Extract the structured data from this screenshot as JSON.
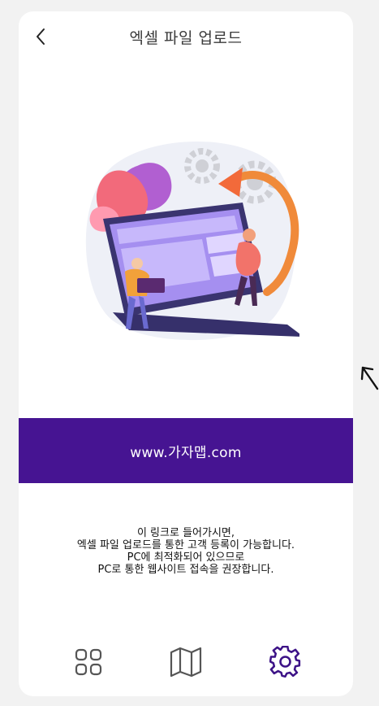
{
  "header": {
    "title": "엑셀 파일 업로드",
    "back_icon": "chevron-left-icon"
  },
  "banner": {
    "link_text": "www.가자맵.com",
    "background_color": "#461492",
    "text_color": "#ffffff"
  },
  "info": {
    "lines": [
      "이 링크로 들어가시면,",
      "엑셀 파일 업로드를 통한 고객 등록이 가능합니다.",
      "PC에 최적화되어 있으므로",
      "PC로 통한 웹사이트 접속을 권장합니다."
    ]
  },
  "bottom_nav": {
    "items": [
      {
        "icon": "grid-icon",
        "active": false,
        "color": "#555555"
      },
      {
        "icon": "map-icon",
        "active": false,
        "color": "#555555"
      },
      {
        "icon": "gear-icon",
        "active": true,
        "color": "#3d1387"
      }
    ]
  }
}
